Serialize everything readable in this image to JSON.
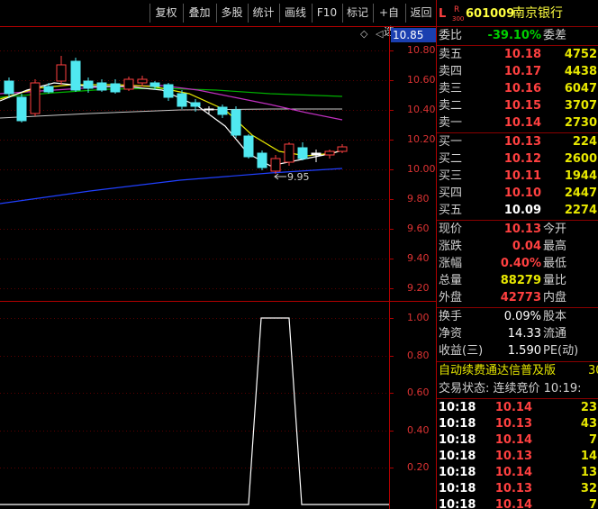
{
  "toolbar": {
    "buttons": [
      "复权",
      "叠加",
      "多股",
      "统计",
      "画线",
      "F10",
      "标记",
      "+自选",
      "返回"
    ]
  },
  "price_tag": "10.85",
  "price_axis": [
    "10.80",
    "10.60",
    "10.40",
    "10.20",
    "10.00",
    "9.80",
    "9.60",
    "9.40",
    "9.20"
  ],
  "low_marker": "9.95",
  "indicator_axis": [
    "1.00",
    "0.80",
    "0.60",
    "0.40",
    "0.20"
  ],
  "stock": {
    "prefix": "L",
    "badge_top": "R",
    "badge_bottom": "300",
    "code": "601009",
    "name": "南京银行"
  },
  "weibi": {
    "label": "委比",
    "value": "-39.10%",
    "label2": "委差"
  },
  "asks": [
    {
      "label": "卖五",
      "price": "10.18",
      "volume": "4752"
    },
    {
      "label": "卖四",
      "price": "10.17",
      "volume": "4438"
    },
    {
      "label": "卖三",
      "price": "10.16",
      "volume": "6047"
    },
    {
      "label": "卖二",
      "price": "10.15",
      "volume": "3707"
    },
    {
      "label": "卖一",
      "price": "10.14",
      "volume": "2730"
    }
  ],
  "bids": [
    {
      "label": "买一",
      "price": "10.13",
      "volume": "224"
    },
    {
      "label": "买二",
      "price": "10.12",
      "volume": "2600"
    },
    {
      "label": "买三",
      "price": "10.11",
      "volume": "1944"
    },
    {
      "label": "买四",
      "price": "10.10",
      "volume": "2447"
    },
    {
      "label": "买五",
      "price": "10.09",
      "volume": "2274"
    }
  ],
  "stats": [
    {
      "label": "现价",
      "value": "10.13",
      "label2": "今开"
    },
    {
      "label": "涨跌",
      "value": "0.04",
      "label2": "最高"
    },
    {
      "label": "涨幅",
      "value": "0.40%",
      "label2": "最低"
    },
    {
      "label": "总量",
      "value": "88279",
      "label2": "量比"
    },
    {
      "label": "外盘",
      "value": "42773",
      "label2": "内盘"
    }
  ],
  "stats2": [
    {
      "label": "换手",
      "value": "0.09%",
      "label2": "股本"
    },
    {
      "label": "净资",
      "value": "14.33",
      "label2": "流通"
    },
    {
      "label": "收益(三)",
      "value": "1.590",
      "label2": "PE(动)"
    }
  ],
  "banner": "自动续费通达信普及版",
  "banner_extra": "30",
  "trade_status": "交易状态: 连续竞价 10:19:",
  "ticks": [
    {
      "time": "10:18",
      "price": "10.14",
      "vol": "23"
    },
    {
      "time": "10:18",
      "price": "10.13",
      "vol": "43"
    },
    {
      "time": "10:18",
      "price": "10.14",
      "vol": "7"
    },
    {
      "time": "10:18",
      "price": "10.13",
      "vol": "14"
    },
    {
      "time": "10:18",
      "price": "10.14",
      "vol": "13"
    },
    {
      "time": "10:18",
      "price": "10.13",
      "vol": "32"
    },
    {
      "time": "10:18",
      "price": "10.14",
      "vol": "7"
    }
  ]
}
